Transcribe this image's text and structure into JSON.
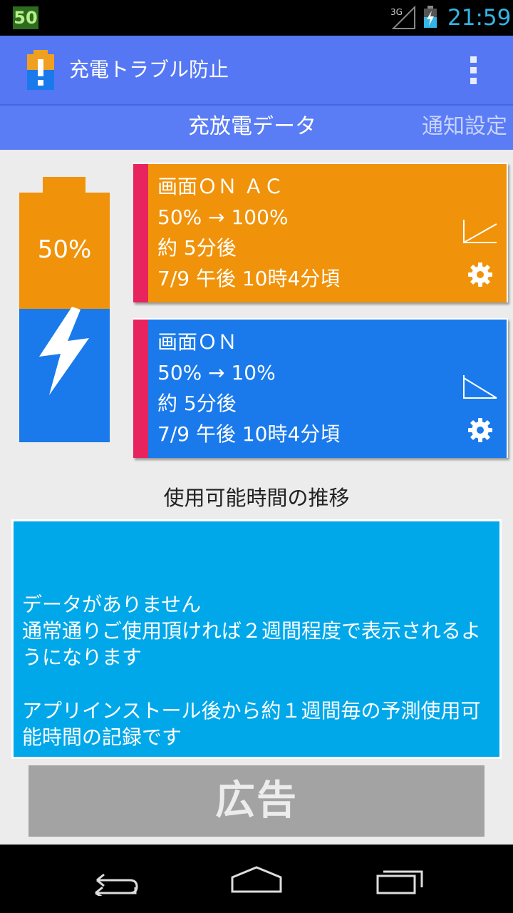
{
  "status_bar": {
    "badge": "50",
    "network": "3G",
    "time": "21:59",
    "time_color": "#33b5e5",
    "icons": [
      "signal-icon",
      "battery-charging-icon"
    ]
  },
  "action_bar": {
    "title": "充電トラブル防止",
    "background": "#5577f3",
    "icons": [
      "app-battery-icon",
      "overflow-menu-icon"
    ]
  },
  "tabs": {
    "active": "充放電データ",
    "next": "通知設定"
  },
  "battery": {
    "percent_label": "50%",
    "level": 0.5,
    "top_color": "#f0930a",
    "bottom_color": "#1a7aeb"
  },
  "cards": [
    {
      "title": "画面ＯＮ ＡＣ",
      "range": "50% → 100%",
      "eta": "約 5分後",
      "time": "7/9 午後 10時4分頃",
      "color": "#f0930a",
      "graph_icon": "rising-line-icon",
      "settings_icon": "gear-icon"
    },
    {
      "title": "画面ＯＮ",
      "range": "50% → 10%",
      "eta": "約 5分後",
      "time": "7/9 午後 10時4分頃",
      "color": "#1a7aeb",
      "graph_icon": "falling-line-icon",
      "settings_icon": "gear-icon"
    }
  ],
  "section": {
    "title": "使用可能時間の推移"
  },
  "info_panel": {
    "line1": "データがありません",
    "line2": "通常通りご使用頂ければ２週間程度で表示されるようになります",
    "line3": "アプリインストール後から約１週間毎の予測使用可能時間の記録です",
    "background": "#00a8ea"
  },
  "ad": {
    "label": "広告"
  },
  "nav_bar": {
    "icons": [
      "back-icon",
      "home-icon",
      "recent-apps-icon"
    ]
  }
}
